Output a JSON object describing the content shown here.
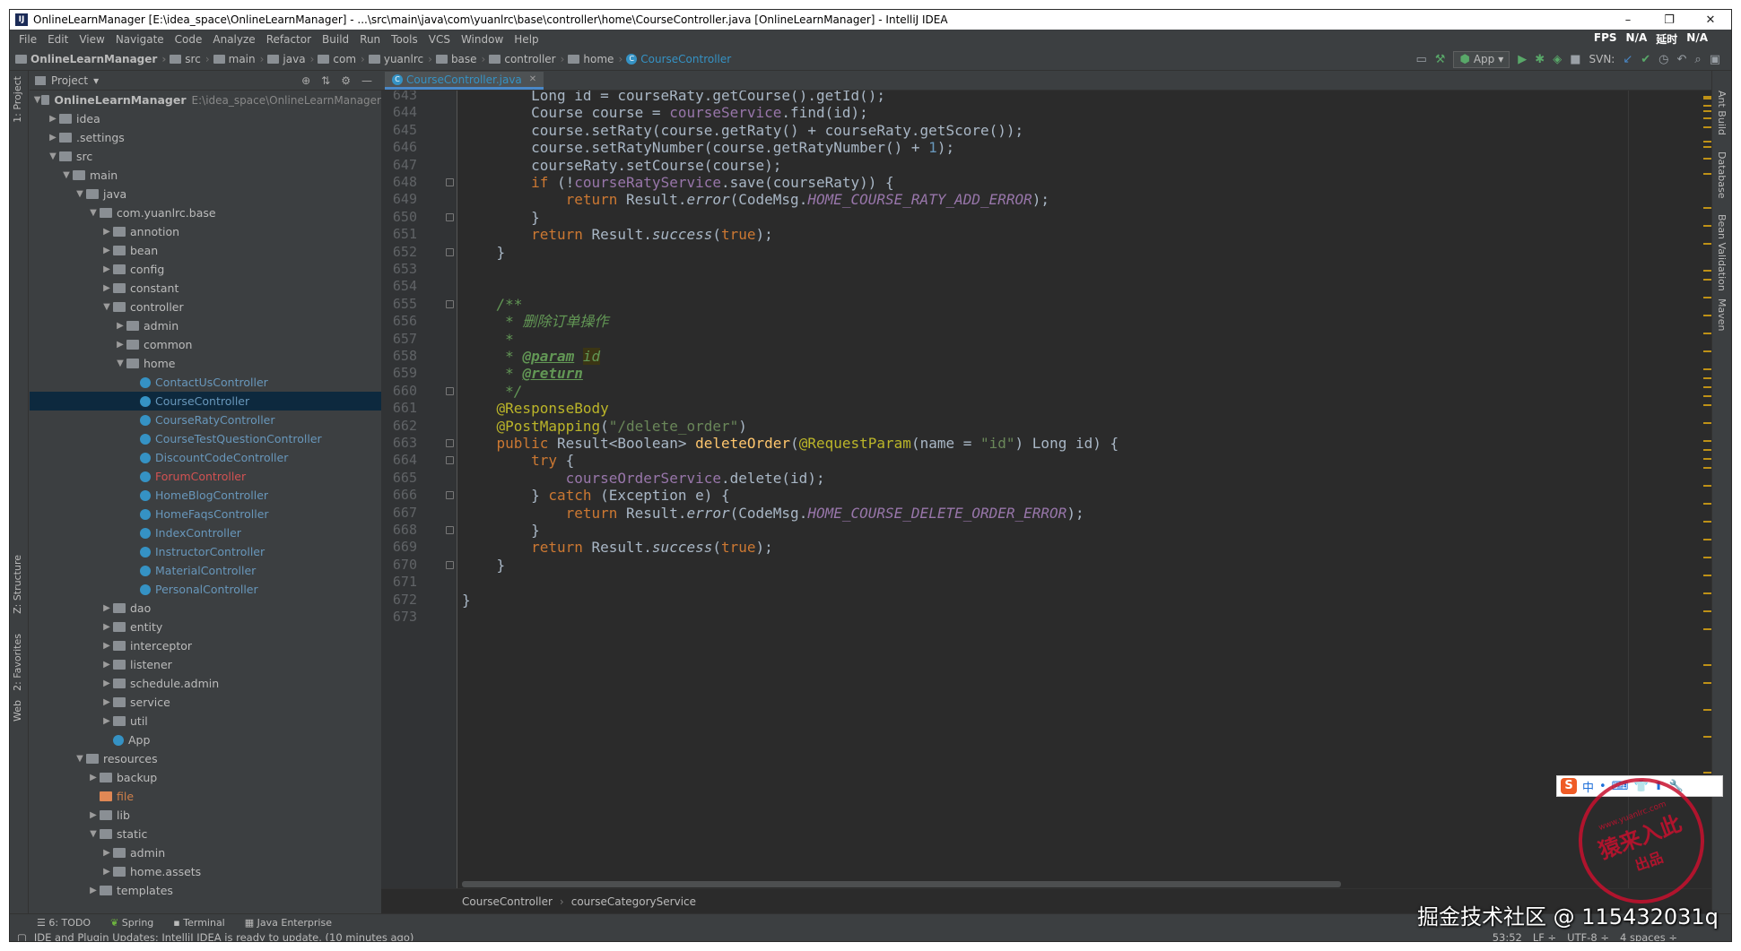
{
  "titlebar": {
    "title": "OnlineLearnManager [E:\\idea_space\\OnlineLearnManager] - ...\\src\\main\\java\\com\\yuanlrc\\base\\controller\\home\\CourseController.java [OnlineLearnManager] - IntelliJ IDEA",
    "minimize": "–",
    "maximize": "❐",
    "close": "✕"
  },
  "menu": {
    "items": [
      "File",
      "Edit",
      "View",
      "Navigate",
      "Code",
      "Analyze",
      "Refactor",
      "Build",
      "Run",
      "Tools",
      "VCS",
      "Window",
      "Help"
    ],
    "right": [
      "FPS",
      "N/A",
      "延时",
      "N/A"
    ]
  },
  "nav": {
    "crumbs": [
      "OnlineLearnManager",
      "src",
      "main",
      "java",
      "com",
      "yuanlrc",
      "base",
      "controller",
      "home",
      "CourseController"
    ],
    "run_config": "App",
    "svn_label": "SVN:"
  },
  "left_stripe": [
    "1: Project",
    "Z: Structure",
    "2: Favorites",
    "Web"
  ],
  "right_stripe": [
    "Ant Build",
    "Database",
    "Bean Validation",
    "Maven"
  ],
  "project": {
    "header": "Project",
    "root_label": "OnlineLearnManager",
    "root_path": "E:\\idea_space\\OnlineLearnManager",
    "tree": [
      {
        "label": "idea",
        "indent": 1,
        "arrow": "▶",
        "icon": "folder"
      },
      {
        "label": ".settings",
        "indent": 1,
        "arrow": "▶",
        "icon": "folder"
      },
      {
        "label": "src",
        "indent": 1,
        "arrow": "▼",
        "icon": "folder"
      },
      {
        "label": "main",
        "indent": 2,
        "arrow": "▼",
        "icon": "folder"
      },
      {
        "label": "java",
        "indent": 3,
        "arrow": "▼",
        "icon": "folder"
      },
      {
        "label": "com.yuanlrc.base",
        "indent": 4,
        "arrow": "▼",
        "icon": "folder"
      },
      {
        "label": "annotion",
        "indent": 5,
        "arrow": "▶",
        "icon": "folder"
      },
      {
        "label": "bean",
        "indent": 5,
        "arrow": "▶",
        "icon": "folder"
      },
      {
        "label": "config",
        "indent": 5,
        "arrow": "▶",
        "icon": "folder"
      },
      {
        "label": "constant",
        "indent": 5,
        "arrow": "▶",
        "icon": "folder"
      },
      {
        "label": "controller",
        "indent": 5,
        "arrow": "▼",
        "icon": "folder"
      },
      {
        "label": "admin",
        "indent": 6,
        "arrow": "▶",
        "icon": "folder"
      },
      {
        "label": "common",
        "indent": 6,
        "arrow": "▶",
        "icon": "folder"
      },
      {
        "label": "home",
        "indent": 6,
        "arrow": "▼",
        "icon": "folder"
      },
      {
        "label": "ContactUsController",
        "indent": 7,
        "arrow": "",
        "icon": "class",
        "color": "blue"
      },
      {
        "label": "CourseController",
        "indent": 7,
        "arrow": "",
        "icon": "class",
        "color": "blue",
        "selected": true
      },
      {
        "label": "CourseRatyController",
        "indent": 7,
        "arrow": "",
        "icon": "class",
        "color": "blue"
      },
      {
        "label": "CourseTestQuestionController",
        "indent": 7,
        "arrow": "",
        "icon": "class",
        "color": "blue"
      },
      {
        "label": "DiscountCodeController",
        "indent": 7,
        "arrow": "",
        "icon": "class",
        "color": "blue"
      },
      {
        "label": "ForumController",
        "indent": 7,
        "arrow": "",
        "icon": "class",
        "color": "red"
      },
      {
        "label": "HomeBlogController",
        "indent": 7,
        "arrow": "",
        "icon": "class",
        "color": "blue"
      },
      {
        "label": "HomeFaqsController",
        "indent": 7,
        "arrow": "",
        "icon": "class",
        "color": "blue"
      },
      {
        "label": "IndexController",
        "indent": 7,
        "arrow": "",
        "icon": "class",
        "color": "blue"
      },
      {
        "label": "InstructorController",
        "indent": 7,
        "arrow": "",
        "icon": "class",
        "color": "blue"
      },
      {
        "label": "MaterialController",
        "indent": 7,
        "arrow": "",
        "icon": "class",
        "color": "blue"
      },
      {
        "label": "PersonalController",
        "indent": 7,
        "arrow": "",
        "icon": "class",
        "color": "blue"
      },
      {
        "label": "dao",
        "indent": 5,
        "arrow": "▶",
        "icon": "folder"
      },
      {
        "label": "entity",
        "indent": 5,
        "arrow": "▶",
        "icon": "folder"
      },
      {
        "label": "interceptor",
        "indent": 5,
        "arrow": "▶",
        "icon": "folder"
      },
      {
        "label": "listener",
        "indent": 5,
        "arrow": "▶",
        "icon": "folder"
      },
      {
        "label": "schedule.admin",
        "indent": 5,
        "arrow": "▶",
        "icon": "folder"
      },
      {
        "label": "service",
        "indent": 5,
        "arrow": "▶",
        "icon": "folder"
      },
      {
        "label": "util",
        "indent": 5,
        "arrow": "▶",
        "icon": "folder"
      },
      {
        "label": "App",
        "indent": 5,
        "arrow": "",
        "icon": "class"
      },
      {
        "label": "resources",
        "indent": 3,
        "arrow": "▼",
        "icon": "folder"
      },
      {
        "label": "backup",
        "indent": 4,
        "arrow": "▶",
        "icon": "folder"
      },
      {
        "label": "file",
        "indent": 4,
        "arrow": "",
        "icon": "file",
        "color": "orange"
      },
      {
        "label": "lib",
        "indent": 4,
        "arrow": "▶",
        "icon": "folder"
      },
      {
        "label": "static",
        "indent": 4,
        "arrow": "▼",
        "icon": "folder"
      },
      {
        "label": "admin",
        "indent": 5,
        "arrow": "▶",
        "icon": "folder"
      },
      {
        "label": "home.assets",
        "indent": 5,
        "arrow": "▶",
        "icon": "folder"
      },
      {
        "label": "templates",
        "indent": 4,
        "arrow": "▶",
        "icon": "folder"
      }
    ]
  },
  "editor": {
    "tab": "CourseController.java",
    "line_start": 643,
    "lines": [
      [
        [
          "        Long id = courseRaty.getCourse().getId();",
          ""
        ]
      ],
      [
        [
          "        Course course = ",
          ""
        ],
        [
          "courseService",
          "fld"
        ],
        [
          ".find(id);",
          ""
        ]
      ],
      [
        [
          "        course.setRaty(course.getRaty() + courseRaty.getScore());",
          ""
        ]
      ],
      [
        [
          "        course.setRatyNumber(course.getRatyNumber() + ",
          ""
        ],
        [
          "1",
          "num"
        ],
        [
          ");",
          ""
        ]
      ],
      [
        [
          "        courseRaty.setCourse(course);",
          ""
        ]
      ],
      [
        [
          "        ",
          ""
        ],
        [
          "if",
          "kw"
        ],
        [
          " (!",
          ""
        ],
        [
          "courseRatyService",
          "fld"
        ],
        [
          ".save(courseRaty)) {",
          ""
        ]
      ],
      [
        [
          "            ",
          ""
        ],
        [
          "return",
          "kw"
        ],
        [
          " Result.",
          ""
        ],
        [
          "error",
          "itl"
        ],
        [
          "(CodeMsg.",
          ""
        ],
        [
          "HOME_COURSE_RATY_ADD_ERROR",
          "cst"
        ],
        [
          ");",
          ""
        ]
      ],
      [
        [
          "        }",
          ""
        ]
      ],
      [
        [
          "        ",
          ""
        ],
        [
          "return",
          "kw"
        ],
        [
          " Result.",
          ""
        ],
        [
          "success",
          "itl"
        ],
        [
          "(",
          ""
        ],
        [
          "true",
          "kw"
        ],
        [
          ");",
          ""
        ]
      ],
      [
        [
          "    }",
          ""
        ]
      ],
      [
        [
          "",
          ""
        ]
      ],
      [
        [
          "",
          ""
        ]
      ],
      [
        [
          "    /**",
          "cmt"
        ]
      ],
      [
        [
          "     * 删除订单操作",
          "cmt"
        ]
      ],
      [
        [
          "     *",
          "cmt"
        ]
      ],
      [
        [
          "     * ",
          "cmt"
        ],
        [
          "@param",
          "tag"
        ],
        [
          " ",
          "cmt"
        ],
        [
          "id",
          "hlc"
        ]
      ],
      [
        [
          "     * ",
          "cmt"
        ],
        [
          "@return",
          "tag"
        ]
      ],
      [
        [
          "     */",
          "cmt"
        ]
      ],
      [
        [
          "    ",
          ""
        ],
        [
          "@ResponseBody",
          "ann"
        ]
      ],
      [
        [
          "    ",
          ""
        ],
        [
          "@PostMapping",
          "ann"
        ],
        [
          "(",
          ""
        ],
        [
          "\"/delete_order\"",
          "str"
        ],
        [
          ")",
          ""
        ]
      ],
      [
        [
          "    ",
          ""
        ],
        [
          "public",
          "kw"
        ],
        [
          " Result<Boolean> ",
          ""
        ],
        [
          "deleteOrder",
          "mth"
        ],
        [
          "(",
          ""
        ],
        [
          "@RequestParam",
          "ann"
        ],
        [
          "(name = ",
          ""
        ],
        [
          "\"id\"",
          "str"
        ],
        [
          ") Long id) {",
          ""
        ]
      ],
      [
        [
          "        ",
          ""
        ],
        [
          "try",
          "kw"
        ],
        [
          " {",
          ""
        ]
      ],
      [
        [
          "            ",
          ""
        ],
        [
          "courseOrderService",
          "fld"
        ],
        [
          ".delete(id);",
          ""
        ]
      ],
      [
        [
          "        } ",
          ""
        ],
        [
          "catch",
          "kw"
        ],
        [
          " (Exception e) {",
          ""
        ]
      ],
      [
        [
          "            ",
          ""
        ],
        [
          "return",
          "kw"
        ],
        [
          " Result.",
          ""
        ],
        [
          "error",
          "itl"
        ],
        [
          "(CodeMsg.",
          ""
        ],
        [
          "HOME_COURSE_DELETE_ORDER_ERROR",
          "cst"
        ],
        [
          ");",
          ""
        ]
      ],
      [
        [
          "        }",
          ""
        ]
      ],
      [
        [
          "        ",
          ""
        ],
        [
          "return",
          "kw"
        ],
        [
          " Result.",
          ""
        ],
        [
          "success",
          "itl"
        ],
        [
          "(",
          ""
        ],
        [
          "true",
          "kw"
        ],
        [
          ");",
          ""
        ]
      ],
      [
        [
          "    }",
          ""
        ]
      ],
      [
        [
          "",
          ""
        ]
      ],
      [
        [
          "}",
          ""
        ]
      ],
      [
        [
          "",
          ""
        ]
      ]
    ],
    "breadcrumb": [
      "CourseController",
      "courseCategoryService"
    ]
  },
  "tool_windows": [
    "6: TODO",
    "Spring",
    "Terminal",
    "Java Enterprise"
  ],
  "status": {
    "message": "IDE and Plugin Updates: IntelliJ IDEA is ready to update. (10 minutes ago)",
    "position": "53:52",
    "line_sep": "LF ÷",
    "encoding": "UTF-8 ÷",
    "indent": "4 spaces ÷"
  },
  "overlay": {
    "ime": [
      "S",
      "中",
      "•",
      "⌨",
      "👕",
      "⬆",
      "🔧"
    ],
    "stamp_big": "猿来入此",
    "stamp_url": "www.yuanlrc.com",
    "stamp_small": "出品",
    "watermark": "掘金技术社区 @ 115432031q"
  },
  "colors": {
    "keyword": "#cc7832",
    "field": "#9876aa",
    "string": "#6a8759",
    "annotation": "#bbb529",
    "method": "#ffc66d",
    "comment": "#629755",
    "editor_bg": "#2b2b2b",
    "panel_bg": "#3c3f41",
    "selection": "#0d293e"
  }
}
